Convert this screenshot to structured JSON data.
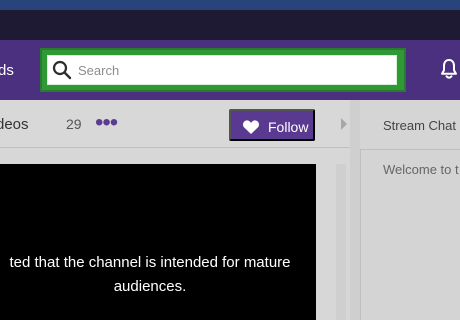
{
  "header": {
    "nav_left_label": "ds",
    "search": {
      "placeholder": "Search",
      "value": ""
    }
  },
  "channel": {
    "tab_label": "deos",
    "tab_count": "29",
    "more_label": "•••",
    "follow_label": "Follow"
  },
  "player": {
    "message_line_1": "ted that the channel is intended for mature",
    "message_line_2": "audiences."
  },
  "chat": {
    "title": "Stream Chat",
    "welcome": "Welcome to t"
  },
  "colors": {
    "nav_purple": "#4a307e",
    "search_highlight_green": "#2f9936",
    "follow_purple": "#5a3a90"
  },
  "icons": {
    "search": "search-icon",
    "bell": "bell-icon",
    "heart": "heart-icon",
    "arrow": "chevron-right-icon"
  }
}
